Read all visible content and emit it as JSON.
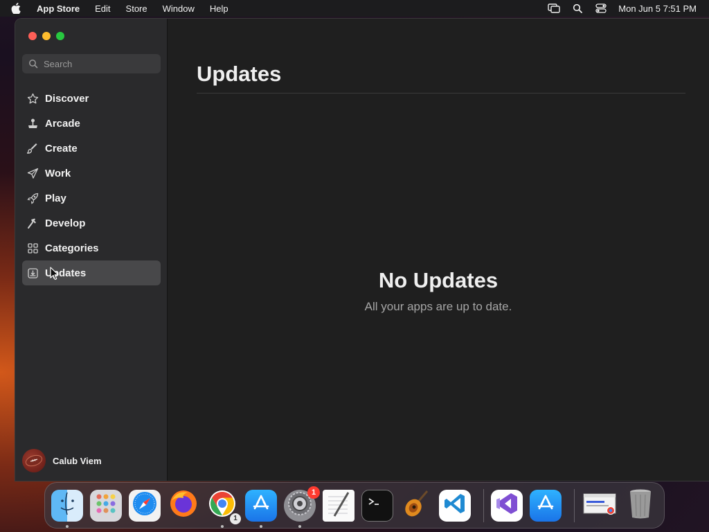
{
  "menubar": {
    "app_name": "App Store",
    "items": [
      "Edit",
      "Store",
      "Window",
      "Help"
    ],
    "clock": "Mon Jun 5  7:51 PM"
  },
  "sidebar": {
    "search_placeholder": "Search",
    "items": [
      {
        "label": "Discover",
        "icon": "star-icon"
      },
      {
        "label": "Arcade",
        "icon": "joystick-icon"
      },
      {
        "label": "Create",
        "icon": "brush-icon"
      },
      {
        "label": "Work",
        "icon": "paper-plane-icon"
      },
      {
        "label": "Play",
        "icon": "rocket-icon"
      },
      {
        "label": "Develop",
        "icon": "hammer-icon"
      },
      {
        "label": "Categories",
        "icon": "grid-icon"
      },
      {
        "label": "Updates",
        "icon": "download-tray-icon"
      }
    ],
    "active": "Updates",
    "profile_name": "Calub Viem"
  },
  "main": {
    "title": "Updates",
    "empty_title": "No Updates",
    "empty_subtitle": "All your apps are up to date."
  },
  "dock": {
    "items": [
      "Finder",
      "Launchpad",
      "Safari",
      "Firefox",
      "Google Chrome",
      "App Store",
      "System Settings",
      "TextEdit",
      "Terminal",
      "GarageBand",
      "Visual Studio Code",
      "Visual Studio",
      "App Store"
    ],
    "chrome_badge": "1",
    "settings_badge": "1"
  },
  "colors": {
    "accent_red": "#fe5f57",
    "accent_yellow": "#febc2e",
    "accent_green": "#28c840",
    "sidebar_bg": "#2a2a2c",
    "main_bg": "#1f1f1f"
  }
}
